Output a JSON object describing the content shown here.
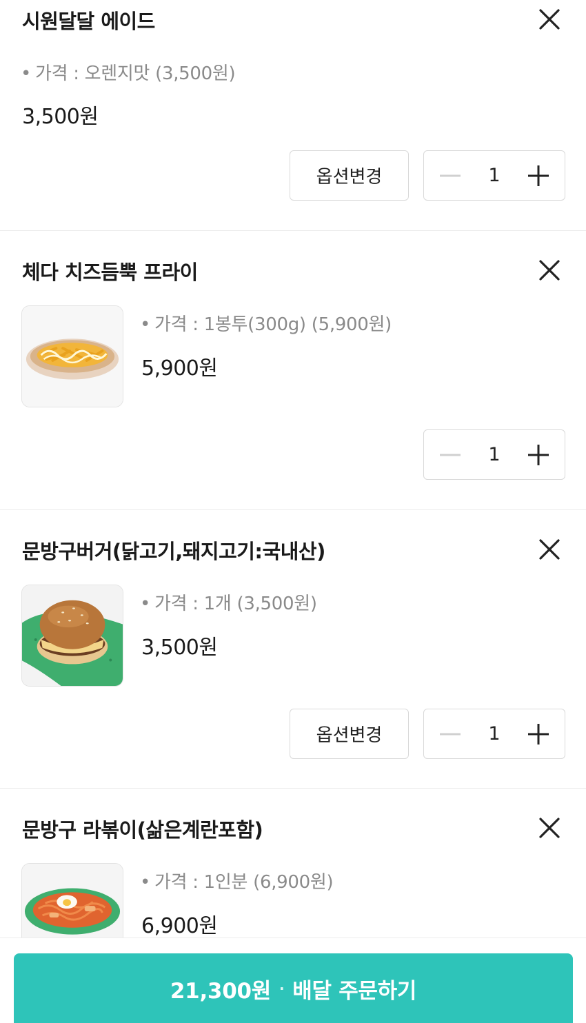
{
  "items": [
    {
      "name": "시원달달 에이드",
      "option_line": "가격 : 오렌지맛 (3,500원)",
      "price": "3,500원",
      "option_change_label": "옵션변경",
      "quantity": "1",
      "has_image": false
    },
    {
      "name": "체다 치즈듬뿍 프라이",
      "option_line": "가격 : 1봉투(300g) (5,900원)",
      "price": "5,900원",
      "quantity": "1",
      "has_image": true,
      "image_icon": "cheese-fries-image"
    },
    {
      "name": "문방구버거(닭고기,돼지고기:국내산)",
      "option_line": "가격 : 1개 (3,500원)",
      "price": "3,500원",
      "option_change_label": "옵션변경",
      "quantity": "1",
      "has_image": true,
      "image_icon": "burger-image"
    },
    {
      "name": "문방구 라볶이(삶은계란포함)",
      "option_line": "가격 : 1인분 (6,900원)",
      "price": "6,900원",
      "has_image": true,
      "image_icon": "rabokki-image"
    }
  ],
  "order_button": {
    "total": "21,300원",
    "separator": "·",
    "label": "배달 주문하기"
  },
  "icons": {
    "remove": "close-icon",
    "minus": "minus-icon",
    "plus": "plus-icon"
  },
  "colors": {
    "accent": "#2ec4b9",
    "minus_disabled": "#d0d0d0"
  }
}
